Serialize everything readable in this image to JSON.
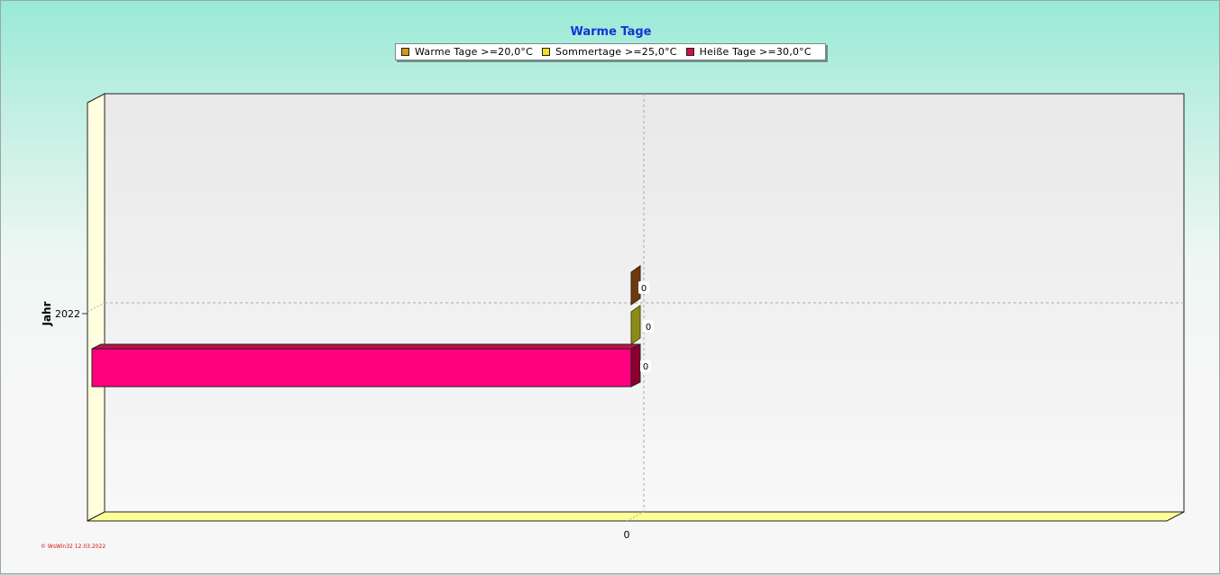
{
  "chart_data": {
    "type": "bar",
    "orientation": "horizontal",
    "title": "Warme Tage",
    "ylabel": "Jahr",
    "categories": [
      "2022"
    ],
    "series": [
      {
        "name": "Warme Tage >=20,0°C",
        "values": [
          0
        ],
        "color": "#8b4513"
      },
      {
        "name": "Sommertage >=25,0°C",
        "values": [
          0
        ],
        "color": "#9a9a10"
      },
      {
        "name": "Heiße Tage >=30,0°C",
        "values": [
          0
        ],
        "color": "#ff007f"
      }
    ],
    "x_ticks": [
      "0"
    ],
    "data_labels": [
      "0",
      "0",
      "0"
    ],
    "legend": "top",
    "grid": true
  },
  "footer_text": "© WsWin32  12.03.2022"
}
